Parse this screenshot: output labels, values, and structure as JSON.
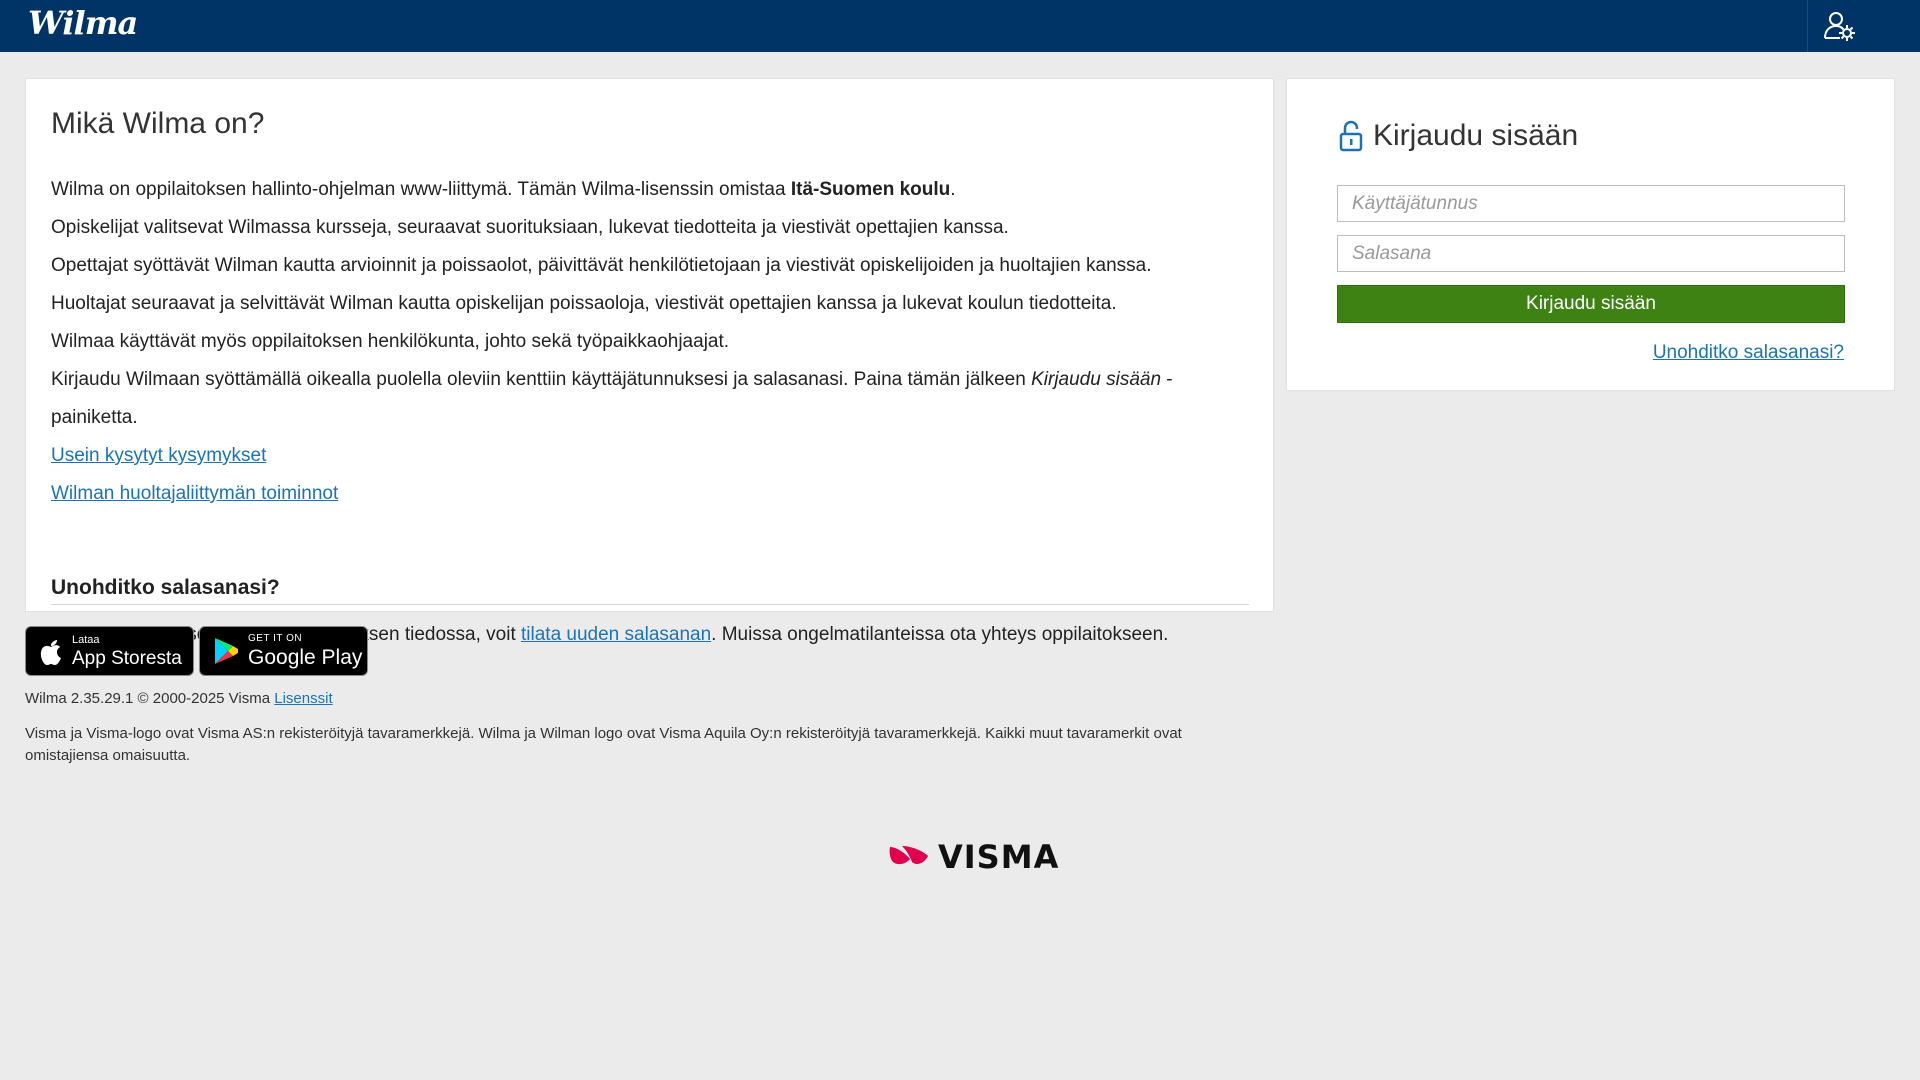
{
  "header": {
    "logo_text": "Wilma",
    "user_settings_icon": "user-gear-icon"
  },
  "info": {
    "title": "Mikä Wilma on?",
    "p1_text": "Wilma on oppilaitoksen hallinto-ohjelman www-liittymä. Tämän Wilma-lisenssin omistaa ",
    "p1_school": "Itä-Suomen koulu",
    "p1_end": ".",
    "p2": "Opiskelijat valitsevat Wilmassa kursseja, seuraavat suorituksiaan, lukevat tiedotteita ja viestivät opettajien kanssa.",
    "p3": "Opettajat syöttävät Wilman kautta arvioinnit ja poissaolot, päivittävät henkilötietojaan ja viestivät opiskelijoiden ja huoltajien kanssa.",
    "p4": "Huoltajat seuraavat ja selvittävät Wilman kautta opiskelijan poissaoloja, viestivät opettajien kanssa ja lukevat koulun tiedotteita.",
    "p5": "Wilmaa käyttävät myös oppilaitoksen henkilökunta, johto sekä työpaikkaohjaajat.",
    "p6_start": "Kirjaudu Wilmaan syöttämällä oikealla puolella oleviin kenttiin käyttäjätunnuksesi ja salasanasi. Paina tämän jälkeen ",
    "p6_em": "Kirjaudu sisään",
    "p6_end": " -painiketta.",
    "link_faq": "Usein kysytyt kysymykset",
    "link_guardian": "Wilman huoltajaliittymän toiminnot",
    "forgot_heading": "Unohditko salasanasi?",
    "forgot_start": "Jos sähköpostiosoitteesi on oppilaitoksen tiedossa, voit ",
    "forgot_link": "tilata uuden salasanan",
    "forgot_end": ". Muissa ongelmatilanteissa ota yhteys oppilaitokseen."
  },
  "login": {
    "title": "Kirjaudu sisään",
    "username_placeholder": "Käyttäjätunnus",
    "password_placeholder": "Salasana",
    "button_label": "Kirjaudu sisään",
    "forgot_link": "Unohditko salasanasi?",
    "button_color": "#3e8213"
  },
  "badges": {
    "appstore_small": "Lataa",
    "appstore_big": "App Storesta",
    "googleplay_small": "GET IT ON",
    "googleplay_big": "Google Play"
  },
  "footer": {
    "version": "Wilma 2.35.29.1 © 2000-2025 Visma ",
    "licenses_link": "Lisenssit",
    "legal": "Visma ja Visma-logo ovat Visma AS:n rekisteröityjä tavaramerkkejä. Wilma ja Wilman logo ovat Visma Aquila Oy:n rekisteröityjä tavaramerkkejä. Kaikki muut tavaramerkit ovat omistajiensa omaisuutta.",
    "visma_wordmark": "VISMA"
  },
  "colors": {
    "topbar": "#003366",
    "link": "#1a73b8",
    "visma_red": "#e0004d"
  }
}
